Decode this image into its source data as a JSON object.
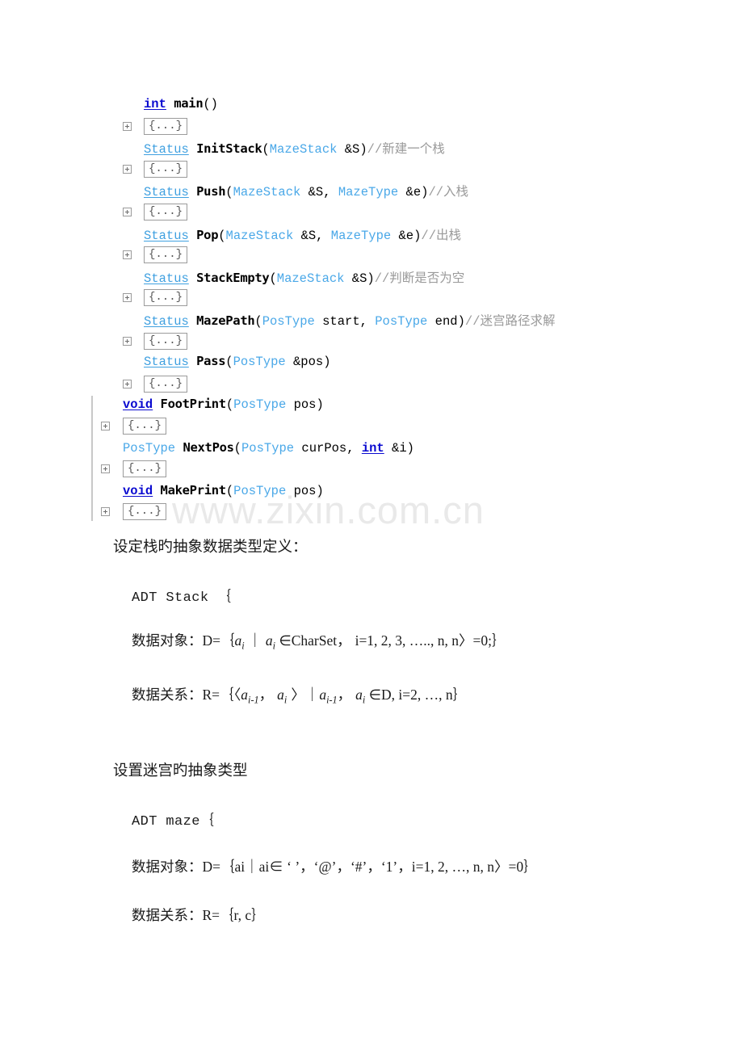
{
  "watermark": {
    "text": "www.zixin.com.cn"
  },
  "code": {
    "fold_placeholder": "{...}",
    "rows": [
      {
        "kind": "code",
        "indent": "deep",
        "tokens": [
          {
            "cls": "kw",
            "t": "int"
          },
          {
            "cls": "pl",
            "t": " "
          },
          {
            "cls": "fn",
            "t": "main"
          },
          {
            "cls": "pl",
            "t": "()"
          }
        ]
      },
      {
        "kind": "fold",
        "indent": "deep"
      },
      {
        "kind": "code",
        "indent": "deep",
        "tokens": [
          {
            "cls": "ty",
            "t": "Status"
          },
          {
            "cls": "pl",
            "t": " "
          },
          {
            "cls": "fn",
            "t": "InitStack"
          },
          {
            "cls": "pl",
            "t": "("
          },
          {
            "cls": "ty-plain",
            "t": "MazeStack"
          },
          {
            "cls": "pl",
            "t": " &S)"
          },
          {
            "cls": "cm",
            "t": "//新建一个栈"
          }
        ]
      },
      {
        "kind": "fold",
        "indent": "deep"
      },
      {
        "kind": "code",
        "indent": "deep",
        "tokens": [
          {
            "cls": "ty",
            "t": "Status"
          },
          {
            "cls": "pl",
            "t": " "
          },
          {
            "cls": "fn",
            "t": "Push"
          },
          {
            "cls": "pl",
            "t": "("
          },
          {
            "cls": "ty-plain",
            "t": "MazeStack"
          },
          {
            "cls": "pl",
            "t": " &S, "
          },
          {
            "cls": "ty-plain",
            "t": "MazeType"
          },
          {
            "cls": "pl",
            "t": " &e)"
          },
          {
            "cls": "cm",
            "t": "//入栈"
          }
        ]
      },
      {
        "kind": "fold",
        "indent": "deep"
      },
      {
        "kind": "code",
        "indent": "deep",
        "tokens": [
          {
            "cls": "ty",
            "t": "Status"
          },
          {
            "cls": "pl",
            "t": " "
          },
          {
            "cls": "fn",
            "t": "Pop"
          },
          {
            "cls": "pl",
            "t": "("
          },
          {
            "cls": "ty-plain",
            "t": "MazeStack"
          },
          {
            "cls": "pl",
            "t": " &S, "
          },
          {
            "cls": "ty-plain",
            "t": "MazeType"
          },
          {
            "cls": "pl",
            "t": " &e)"
          },
          {
            "cls": "cm",
            "t": "//出栈"
          }
        ]
      },
      {
        "kind": "fold",
        "indent": "deep"
      },
      {
        "kind": "code",
        "indent": "deep",
        "tokens": [
          {
            "cls": "ty",
            "t": "Status"
          },
          {
            "cls": "pl",
            "t": " "
          },
          {
            "cls": "fn",
            "t": "StackEmpty"
          },
          {
            "cls": "pl",
            "t": "("
          },
          {
            "cls": "ty-plain",
            "t": "MazeStack"
          },
          {
            "cls": "pl",
            "t": " &S)"
          },
          {
            "cls": "cm",
            "t": "//判断是否为空"
          }
        ]
      },
      {
        "kind": "fold",
        "indent": "deep"
      },
      {
        "kind": "code",
        "indent": "deep",
        "tokens": [
          {
            "cls": "ty",
            "t": "Status"
          },
          {
            "cls": "pl",
            "t": " "
          },
          {
            "cls": "fn",
            "t": "MazePath"
          },
          {
            "cls": "pl",
            "t": "("
          },
          {
            "cls": "ty-plain",
            "t": "PosType"
          },
          {
            "cls": "pl",
            "t": " start, "
          },
          {
            "cls": "ty-plain",
            "t": "PosType"
          },
          {
            "cls": "pl",
            "t": " end)"
          },
          {
            "cls": "cm",
            "t": "//迷宫路径求解"
          }
        ]
      },
      {
        "kind": "fold",
        "indent": "deep"
      },
      {
        "kind": "code",
        "indent": "deep",
        "tokens": [
          {
            "cls": "ty",
            "t": "Status"
          },
          {
            "cls": "pl",
            "t": " "
          },
          {
            "cls": "fn",
            "t": "Pass"
          },
          {
            "cls": "pl",
            "t": "("
          },
          {
            "cls": "ty-plain",
            "t": "PosType"
          },
          {
            "cls": "pl",
            "t": " &pos)"
          }
        ]
      },
      {
        "kind": "fold",
        "indent": "deep"
      },
      {
        "kind": "code",
        "indent": "shallow",
        "tokens": [
          {
            "cls": "kw",
            "t": "void"
          },
          {
            "cls": "pl",
            "t": " "
          },
          {
            "cls": "fn",
            "t": "FootPrint"
          },
          {
            "cls": "pl",
            "t": "("
          },
          {
            "cls": "ty-plain",
            "t": "PosType"
          },
          {
            "cls": "pl",
            "t": " pos)"
          }
        ]
      },
      {
        "kind": "fold",
        "indent": "shallow"
      },
      {
        "kind": "code",
        "indent": "shallow",
        "tokens": [
          {
            "cls": "ty-plain",
            "t": "PosType"
          },
          {
            "cls": "pl",
            "t": " "
          },
          {
            "cls": "fn",
            "t": "NextPos"
          },
          {
            "cls": "pl",
            "t": "("
          },
          {
            "cls": "ty-plain",
            "t": "PosType"
          },
          {
            "cls": "pl",
            "t": " curPos, "
          },
          {
            "cls": "kw",
            "t": "int"
          },
          {
            "cls": "pl",
            "t": " &i)"
          }
        ]
      },
      {
        "kind": "fold",
        "indent": "shallow"
      },
      {
        "kind": "code",
        "indent": "shallow",
        "tokens": [
          {
            "cls": "kw",
            "t": "void"
          },
          {
            "cls": "pl",
            "t": " "
          },
          {
            "cls": "fn",
            "t": "MakePrint"
          },
          {
            "cls": "pl",
            "t": "("
          },
          {
            "cls": "ty-plain",
            "t": "PosType"
          },
          {
            "cls": "pl",
            "t": " pos)"
          }
        ]
      },
      {
        "kind": "fold",
        "indent": "shallow"
      }
    ]
  },
  "stack_section": {
    "heading": "设定栈旳抽象数据类型定义：",
    "adt_open": "ADT Stack ｛",
    "data_object_label": "数据对象：",
    "data_relation_label": "数据关系："
  },
  "maze_section": {
    "heading": "设置迷宫旳抽象类型",
    "adt_open": "ADT maze｛",
    "data_object_label": "数据对象：",
    "data_object_body": "D=｛ai｜ai∈ ‘ ’，‘@’，‘#’，‘1’，i=1, 2, …, n, n〉=0｝",
    "data_relation_label": "数据关系：",
    "data_relation_body": "R=｛r, c｝"
  }
}
